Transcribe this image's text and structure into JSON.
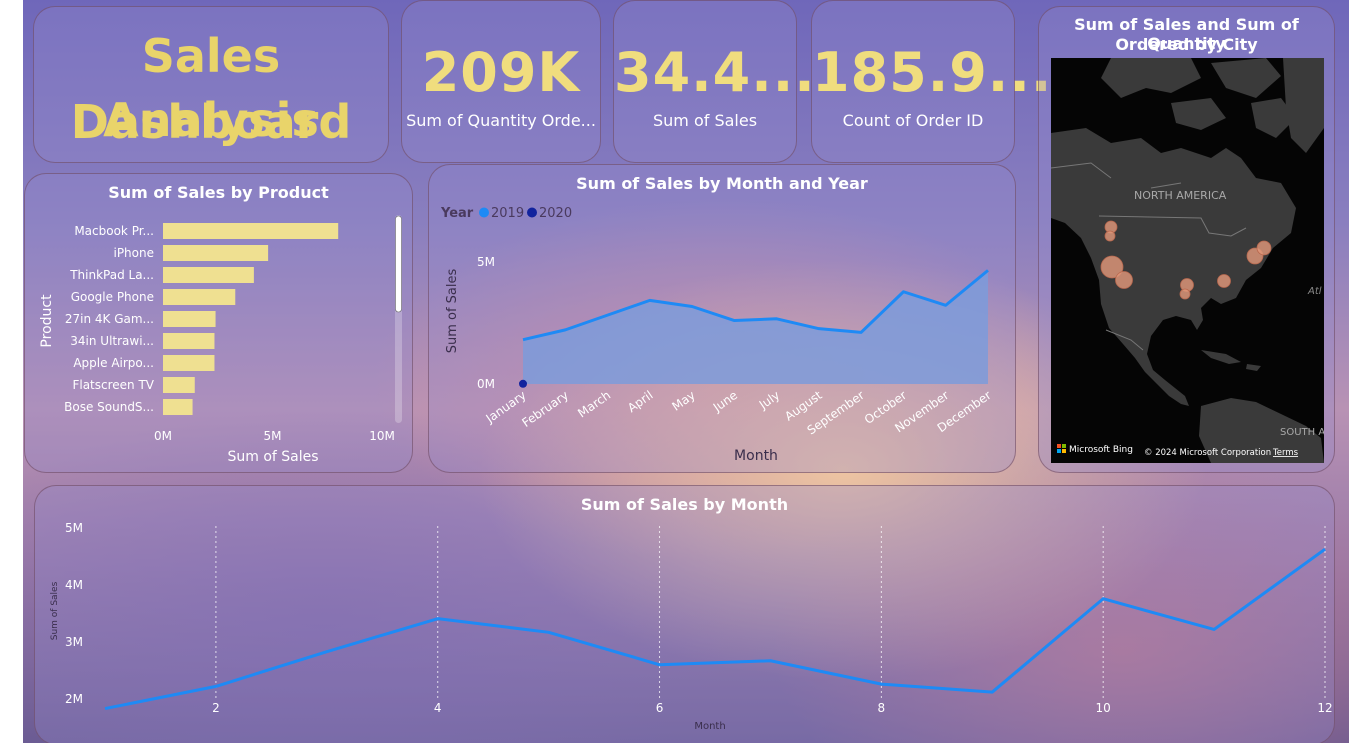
{
  "dashboard": {
    "title_line1": "Sales Analysis",
    "title_line2": "Dashboard"
  },
  "kpis": [
    {
      "value": "209K",
      "label": "Sum of Quantity Orde..."
    },
    {
      "value": "34.4...",
      "label": "Sum of Sales"
    },
    {
      "value": "185.9...",
      "label": "Count of Order ID"
    }
  ],
  "map": {
    "title_line1": "Sum of Sales and Sum of Quantity",
    "title_line2": "Ordered by City",
    "label_continent": "NORTH AMERICA",
    "label_south": "SOUTH A",
    "label_atlantic": "Atl",
    "bing_label": "Microsoft Bing",
    "copyright": "© 2024 Microsoft Corporation",
    "terms": "Terms",
    "colors": {
      "land": "#3a3a3a",
      "water": "#050505",
      "bubble": "#e0977a"
    }
  },
  "colors": {
    "bar": "#efe091",
    "line": "#1e8af5",
    "area": "#7c9bda",
    "series_2019": "#1e8af5",
    "series_2020": "#12239e",
    "title_gold": "#e9d46a"
  },
  "chart_data": [
    {
      "id": "by_product",
      "type": "bar",
      "orientation": "horizontal",
      "title": "Sum of Sales by Product",
      "xlabel": "Sum of Sales",
      "ylabel": "Product",
      "xlim": [
        0,
        10000000
      ],
      "x_ticks": [
        "0M",
        "5M",
        "10M"
      ],
      "categories": [
        "Macbook Pr...",
        "iPhone",
        "ThinkPad La...",
        "Google Phone",
        "27in 4K Gam...",
        "34in Ultrawi...",
        "Apple Airpo...",
        "Flatscreen TV",
        "Bose SoundS..."
      ],
      "values": [
        8000000,
        4800000,
        4150000,
        3300000,
        2400000,
        2350000,
        2350000,
        1450000,
        1350000
      ]
    },
    {
      "id": "by_month_year",
      "type": "area",
      "title": "Sum of Sales by Month and Year",
      "xlabel": "Month",
      "ylabel": "Sum of Sales",
      "legend_title": "Year",
      "legend_position": "top-left",
      "ylim": [
        0,
        5000000
      ],
      "y_ticks": [
        "0M",
        "5M"
      ],
      "categories": [
        "January",
        "February",
        "March",
        "April",
        "May",
        "June",
        "July",
        "August",
        "September",
        "October",
        "November",
        "December"
      ],
      "series": [
        {
          "name": "2019",
          "values": [
            1800000,
            2200000,
            2800000,
            3400000,
            3150000,
            2580000,
            2650000,
            2250000,
            2100000,
            3750000,
            3200000,
            4620000
          ]
        },
        {
          "name": "2020",
          "values": [
            8700,
            null,
            null,
            null,
            null,
            null,
            null,
            null,
            null,
            null,
            null,
            null
          ]
        }
      ]
    },
    {
      "id": "by_month",
      "type": "line",
      "title": "Sum of Sales by Month",
      "xlabel": "Month",
      "ylabel": "Sum of Sales",
      "ylim": [
        1750000,
        5000000
      ],
      "y_ticks": [
        "2M",
        "3M",
        "4M",
        "5M"
      ],
      "x_ticks": [
        "2",
        "4",
        "6",
        "8",
        "10",
        "12"
      ],
      "x": [
        1,
        2,
        3,
        4,
        5,
        6,
        7,
        8,
        9,
        10,
        11,
        12
      ],
      "values": [
        1810000,
        2200000,
        2810000,
        3390000,
        3150000,
        2580000,
        2650000,
        2240000,
        2100000,
        3740000,
        3200000,
        4610000
      ],
      "grid": "vertical dotted"
    }
  ]
}
